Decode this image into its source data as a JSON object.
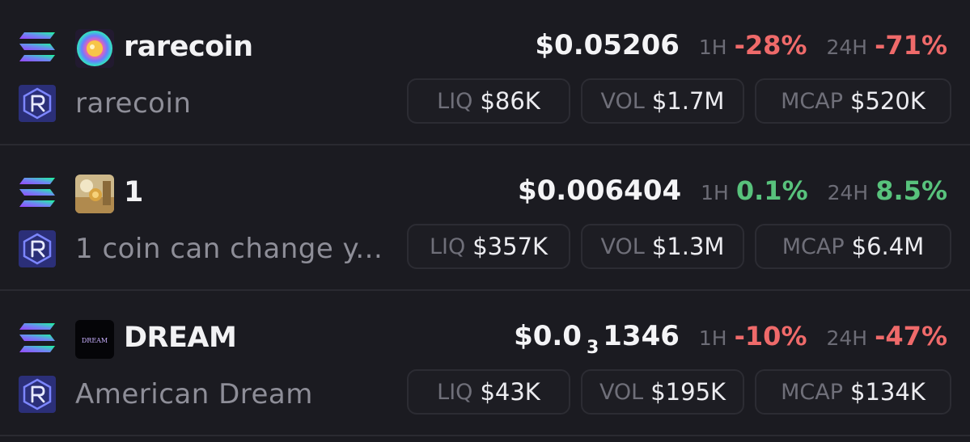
{
  "tokens": [
    {
      "chain_icon": "solana-icon",
      "dex_icon": "raydium-icon",
      "token_icon": "rarecoin-token-icon",
      "symbol": "rarecoin",
      "name": "rarecoin",
      "price": "$0.05206",
      "h1_label": "1H",
      "h1_change": "-28%",
      "h24_label": "24H",
      "h24_change": "-71%",
      "liq_label": "LIQ",
      "liq": "$86K",
      "vol_label": "VOL",
      "vol": "$1.7M",
      "mcap_label": "MCAP",
      "mcap": "$520K"
    },
    {
      "chain_icon": "solana-icon",
      "dex_icon": "raydium-icon",
      "token_icon": "one-token-icon",
      "symbol": "1",
      "name": "1 coin can change y...",
      "price": "$0.006404",
      "h1_label": "1H",
      "h1_change": "0.1%",
      "h24_label": "24H",
      "h24_change": "8.5%",
      "liq_label": "LIQ",
      "liq": "$357K",
      "vol_label": "VOL",
      "vol": "$1.3M",
      "mcap_label": "MCAP",
      "mcap": "$6.4M"
    },
    {
      "chain_icon": "solana-icon",
      "dex_icon": "raydium-icon",
      "token_icon": "dream-token-icon",
      "token_icon_text": "DREAM",
      "symbol": "DREAM",
      "name": "American Dream",
      "price_prefix": "$0.0",
      "price_zeros": "3",
      "price_digits": "1346",
      "h1_label": "1H",
      "h1_change": "-10%",
      "h24_label": "24H",
      "h24_change": "-47%",
      "liq_label": "LIQ",
      "liq": "$43K",
      "vol_label": "VOL",
      "vol": "$195K",
      "mcap_label": "MCAP",
      "mcap": "$134K"
    }
  ],
  "colors": {
    "background": "#1b1b21",
    "negative": "#ef6a6a",
    "positive": "#58c27c",
    "muted": "#8e8e98"
  }
}
